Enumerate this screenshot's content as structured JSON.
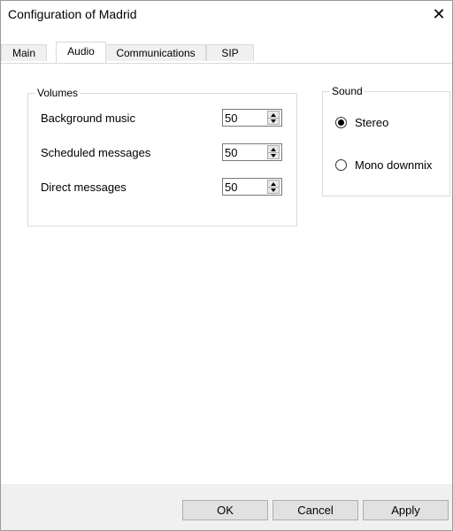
{
  "window": {
    "title": "Configuration of Madrid",
    "close_glyph": "✕"
  },
  "tabs": [
    {
      "label": "Main",
      "active": false
    },
    {
      "label": "Audio",
      "active": true
    },
    {
      "label": "Communications",
      "active": false
    },
    {
      "label": "SIP",
      "active": false
    }
  ],
  "volumes": {
    "legend": "Volumes",
    "items": [
      {
        "label": "Background music",
        "value": "50"
      },
      {
        "label": "Scheduled messages",
        "value": "50"
      },
      {
        "label": "Direct messages",
        "value": "50"
      }
    ]
  },
  "sound": {
    "legend": "Sound",
    "options": [
      {
        "label": "Stereo",
        "selected": true
      },
      {
        "label": "Mono downmix",
        "selected": false
      }
    ]
  },
  "buttons": {
    "ok": "OK",
    "cancel": "Cancel",
    "apply": "Apply"
  },
  "icons": {
    "close": "close-icon",
    "spin_up": "arrow-up-icon",
    "spin_down": "arrow-down-icon"
  }
}
